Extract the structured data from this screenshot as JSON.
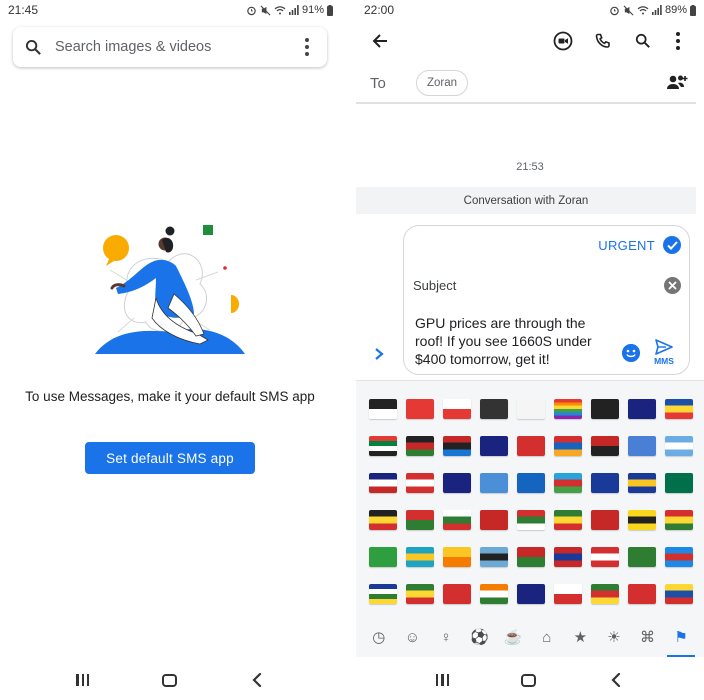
{
  "left": {
    "status": {
      "time": "21:45",
      "battery": "91%"
    },
    "search": {
      "placeholder": "Search images & videos"
    },
    "empty_state": {
      "message": "To use Messages, make it your default SMS app",
      "button_label": "Set default SMS app"
    }
  },
  "right": {
    "status": {
      "time": "22:00",
      "battery": "89%"
    },
    "recipient": {
      "to_label": "To",
      "name": "Zoran"
    },
    "conversation": {
      "timestamp": "21:53",
      "banner": "Conversation with Zoran"
    },
    "compose": {
      "urgent_label": "URGENT",
      "urgent_checked": true,
      "subject_label": "Subject",
      "body": "GPU prices are through the roof! If you see 1660S under $400 tomorrow, get it!",
      "send_type": "MMS"
    },
    "emoji_picker": {
      "active_category": "flags",
      "categories": [
        "recent-icon",
        "smiley-icon",
        "people-icon",
        "activity-icon",
        "food-icon",
        "travel-icon",
        "trophy-icon",
        "objects-icon",
        "symbols-icon",
        "flag-icon"
      ],
      "flags": [
        {
          "name": "chequered-flag",
          "colors": [
            "#222222",
            "#ffffff"
          ]
        },
        {
          "name": "triangular-flag",
          "colors": [
            "#e53935",
            "#e53935"
          ]
        },
        {
          "name": "crossed-flags",
          "colors": [
            "#ffffff",
            "#e53935"
          ]
        },
        {
          "name": "black-flag",
          "colors": [
            "#333333",
            "#333333"
          ]
        },
        {
          "name": "white-flag",
          "colors": [
            "#f5f5f5",
            "#f5f5f5"
          ]
        },
        {
          "name": "rainbow-flag",
          "colors": [
            "#e53935",
            "#fb8c00",
            "#fdd835",
            "#43a047",
            "#1e88e5",
            "#8e24aa"
          ]
        },
        {
          "name": "pirate-flag",
          "colors": [
            "#222222",
            "#222222"
          ]
        },
        {
          "name": "flag-ascension-island",
          "colors": [
            "#1a237e",
            "#1a237e"
          ]
        },
        {
          "name": "flag-andorra",
          "colors": [
            "#1e4fa8",
            "#fdd835",
            "#e53935"
          ]
        },
        {
          "name": "flag-uae",
          "colors": [
            "#e53935",
            "#00843d",
            "#ffffff",
            "#222222"
          ]
        },
        {
          "name": "flag-afghanistan",
          "colors": [
            "#222222",
            "#c62828",
            "#2e7d32"
          ]
        },
        {
          "name": "flag-antigua-barbuda",
          "colors": [
            "#c62828",
            "#222222",
            "#1976d2"
          ]
        },
        {
          "name": "flag-anguilla",
          "colors": [
            "#1a237e",
            "#1a237e"
          ]
        },
        {
          "name": "flag-albania",
          "colors": [
            "#d32f2f",
            "#d32f2f"
          ]
        },
        {
          "name": "flag-armenia",
          "colors": [
            "#d32f2f",
            "#1565c0",
            "#f9a825"
          ]
        },
        {
          "name": "flag-angola",
          "colors": [
            "#c62828",
            "#222222"
          ]
        },
        {
          "name": "flag-antarctica",
          "colors": [
            "#4a7fd6",
            "#4a7fd6"
          ]
        },
        {
          "name": "flag-argentina",
          "colors": [
            "#6cace4",
            "#ffffff",
            "#6cace4"
          ]
        },
        {
          "name": "flag-american-samoa",
          "colors": [
            "#1a237e",
            "#ffffff",
            "#c62828"
          ]
        },
        {
          "name": "flag-austria",
          "colors": [
            "#d32f2f",
            "#ffffff",
            "#d32f2f"
          ]
        },
        {
          "name": "flag-australia",
          "colors": [
            "#1a237e",
            "#1a237e"
          ]
        },
        {
          "name": "flag-aruba",
          "colors": [
            "#4a8fd8",
            "#4a8fd8"
          ]
        },
        {
          "name": "flag-aland-islands",
          "colors": [
            "#1565c0",
            "#1565c0"
          ]
        },
        {
          "name": "flag-azerbaijan",
          "colors": [
            "#29a3dc",
            "#d32f2f",
            "#43a047"
          ]
        },
        {
          "name": "flag-bosnia",
          "colors": [
            "#1a3a99",
            "#1a3a99"
          ]
        },
        {
          "name": "flag-barbados",
          "colors": [
            "#1a3a99",
            "#f9c623",
            "#1a3a99"
          ]
        },
        {
          "name": "flag-bangladesh",
          "colors": [
            "#00704a",
            "#00704a"
          ]
        },
        {
          "name": "flag-belgium",
          "colors": [
            "#222222",
            "#fdd835",
            "#d32f2f"
          ]
        },
        {
          "name": "flag-burkina-faso",
          "colors": [
            "#d32f2f",
            "#2e7d32"
          ]
        },
        {
          "name": "flag-bulgaria",
          "colors": [
            "#ffffff",
            "#2e7d32",
            "#d32f2f"
          ]
        },
        {
          "name": "flag-bahrain",
          "colors": [
            "#c62828",
            "#c62828"
          ]
        },
        {
          "name": "flag-burundi",
          "colors": [
            "#d32f2f",
            "#2e7d32",
            "#ffffff"
          ]
        },
        {
          "name": "flag-benin",
          "colors": [
            "#2e7d32",
            "#fdd835",
            "#d32f2f"
          ]
        },
        {
          "name": "flag-bermuda",
          "colors": [
            "#c62828",
            "#c62828"
          ]
        },
        {
          "name": "flag-brunei",
          "colors": [
            "#f9d71c",
            "#222222",
            "#f9d71c"
          ]
        },
        {
          "name": "flag-bolivia",
          "colors": [
            "#d32f2f",
            "#fdd835",
            "#2e7d32"
          ]
        },
        {
          "name": "flag-brazil",
          "colors": [
            "#2e9e3f",
            "#2e9e3f"
          ]
        },
        {
          "name": "flag-bahamas",
          "colors": [
            "#1fa3c2",
            "#f9c623",
            "#1fa3c2"
          ]
        },
        {
          "name": "flag-bhutan",
          "colors": [
            "#f9c623",
            "#f57c00"
          ]
        },
        {
          "name": "flag-botswana",
          "colors": [
            "#6da9d2",
            "#222222",
            "#6da9d2"
          ]
        },
        {
          "name": "flag-belarus",
          "colors": [
            "#c62828",
            "#2e7d32"
          ]
        },
        {
          "name": "flag-belize",
          "colors": [
            "#c62828",
            "#1a3a99",
            "#c62828"
          ]
        },
        {
          "name": "flag-canada",
          "colors": [
            "#d32f2f",
            "#ffffff",
            "#d32f2f"
          ]
        },
        {
          "name": "flag-cocos-islands",
          "colors": [
            "#2e7d32",
            "#2e7d32"
          ]
        },
        {
          "name": "flag-dr-congo",
          "colors": [
            "#1e88e5",
            "#d32f2f",
            "#1e88e5"
          ]
        },
        {
          "name": "flag-central-african-republic",
          "colors": [
            "#1a3a99",
            "#ffffff",
            "#2e7d32",
            "#fdd835"
          ]
        },
        {
          "name": "flag-congo",
          "colors": [
            "#2e7d32",
            "#fdd835",
            "#d32f2f"
          ]
        },
        {
          "name": "flag-switzerland",
          "colors": [
            "#d32f2f",
            "#d32f2f"
          ]
        },
        {
          "name": "flag-cote-divoire",
          "colors": [
            "#f57c00",
            "#ffffff",
            "#2e7d32"
          ]
        },
        {
          "name": "flag-cook-islands",
          "colors": [
            "#1a237e",
            "#1a237e"
          ]
        },
        {
          "name": "flag-chile",
          "colors": [
            "#ffffff",
            "#d32f2f"
          ]
        },
        {
          "name": "flag-cameroon",
          "colors": [
            "#2e7d32",
            "#d32f2f",
            "#fdd835"
          ]
        },
        {
          "name": "flag-china",
          "colors": [
            "#d32f2f",
            "#d32f2f"
          ]
        },
        {
          "name": "flag-colombia",
          "colors": [
            "#fdd835",
            "#1e4fa8",
            "#d32f2f"
          ]
        }
      ]
    }
  }
}
